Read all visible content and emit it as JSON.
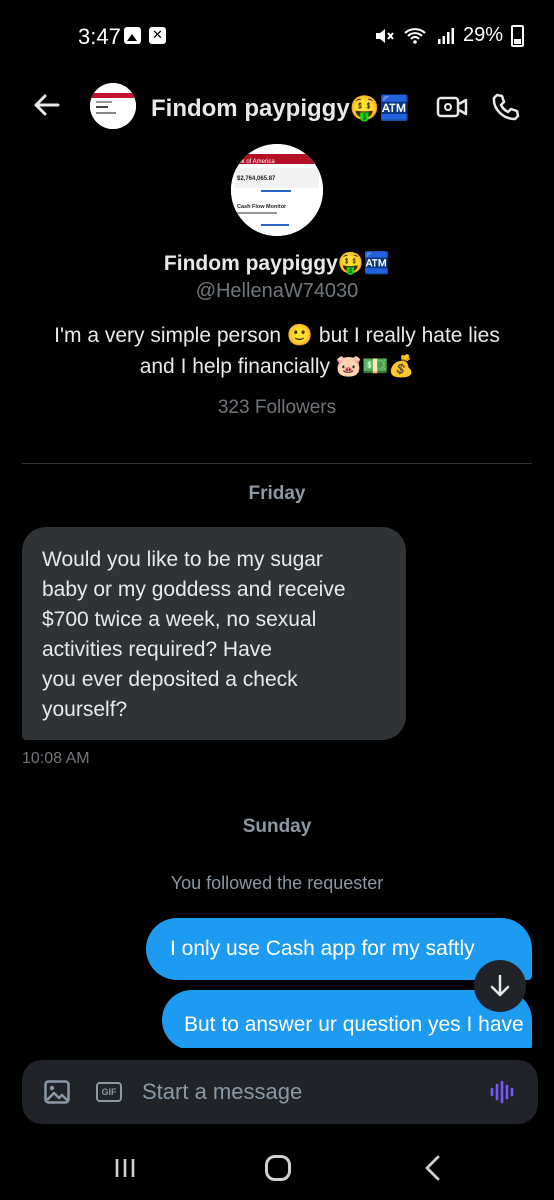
{
  "status_bar": {
    "time": "3:47",
    "battery": "29%"
  },
  "header": {
    "name": "Findom paypiggy🤑🏧"
  },
  "profile": {
    "name": "Findom paypiggy🤑🏧",
    "handle": "@HellenaW74030",
    "bio_line1": "I'm a very simple person 🙂 but I really hate lies",
    "bio_line2": "and I help financially 🐷💵💰",
    "followers": "323 Followers",
    "avatar_bank": "ank of America",
    "avatar_balance": "$2,764,065.87",
    "avatar_caption": "Cash Flow Monitor"
  },
  "conversation": {
    "day1": "Friday",
    "incoming": {
      "lines": [
        "Would you like to be my sugar",
        "baby or my goddess and receive",
        "$700 twice a week, no sexual",
        "activities required? Have",
        "you ever deposited a check",
        "yourself?"
      ],
      "time": "10:08 AM"
    },
    "day2": "Sunday",
    "system": "You followed the requester",
    "outgoing": [
      "I only use Cash app for my saftly",
      "But to answer ur question yes I have"
    ]
  },
  "composer": {
    "placeholder": "Start a message",
    "gif_label": "GIF"
  },
  "colors": {
    "accent": "#1d9bf0",
    "incoming_bubble": "#2f3336",
    "voice": "#7856ff"
  }
}
